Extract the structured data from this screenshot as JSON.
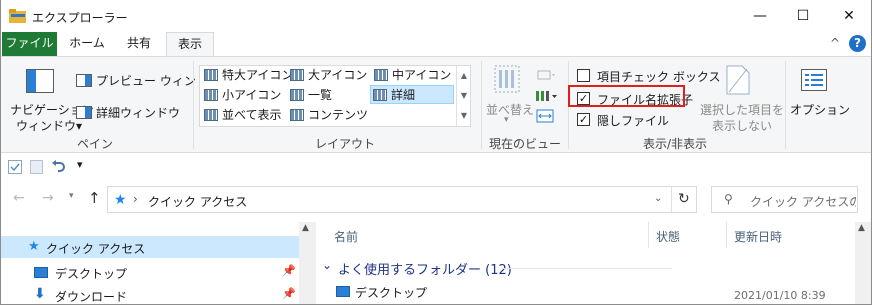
{
  "window": {
    "title": "エクスプローラー",
    "minimize": "—",
    "maximize": "☐",
    "close": "✕"
  },
  "tabs": [
    {
      "label": "ファイル"
    },
    {
      "label": "ホーム"
    },
    {
      "label": "共有"
    },
    {
      "label": "表示"
    }
  ],
  "ribbon_right": {
    "collapse": "^",
    "help": "?"
  },
  "panes_group": {
    "nav_pane_line1": "ナビゲーション",
    "nav_pane_line2": "ウィンドウ▾",
    "preview_pane": "プレビュー ウィンドウ",
    "details_pane": "詳細ウィンドウ",
    "label": "ペイン"
  },
  "layout_group": {
    "items": [
      "特大アイコン",
      "大アイコン",
      "中アイコン",
      "小アイコン",
      "一覧",
      "詳細",
      "並べて表示",
      "コンテンツ"
    ],
    "label": "レイアウト"
  },
  "current_view_group": {
    "sort_line1": "並べ替え",
    "sort_line2": "▾",
    "label": "現在のビュー"
  },
  "show_hide_group": {
    "item_checkbox": "項目チェック ボックス",
    "file_ext": "ファイル名拡張子",
    "hidden_files": "隠しファイル",
    "item_checkbox_checked": false,
    "file_ext_checked": true,
    "hidden_files_checked": true,
    "hide_selected_line1": "選択した項目を",
    "hide_selected_line2": "表示しない",
    "label": "表示/非表示"
  },
  "options": {
    "label": "オプション"
  },
  "address": {
    "path": "クイック アクセス",
    "search_placeholder": "クイック アクセスの検..."
  },
  "nav_pane": {
    "items": [
      {
        "label": "クイック アクセス"
      },
      {
        "label": "デスクトップ"
      },
      {
        "label": "ダウンロード"
      }
    ]
  },
  "content": {
    "columns": [
      "名前",
      "状態",
      "更新日時"
    ],
    "group_header": "よく使用するフォルダー (12)",
    "rows": [
      {
        "name": "デスクトップ",
        "status": "",
        "modified": "2021/01/10 8:39"
      }
    ]
  },
  "colors": {
    "file_tab": "#1e7a34",
    "highlight": "#e02020",
    "selection": "#cce8ff",
    "accent": "#0078d7"
  }
}
